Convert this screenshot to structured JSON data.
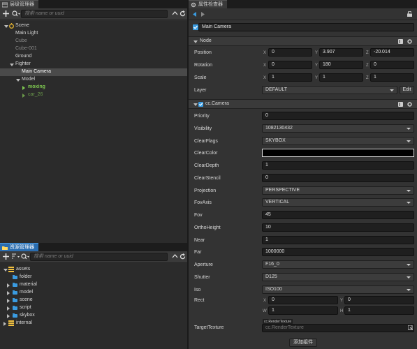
{
  "hierarchy": {
    "tab_label": "层级管理器",
    "search_placeholder": "搜索 name or uuid",
    "items": [
      {
        "label": "Scene"
      },
      {
        "label": "Main Light"
      },
      {
        "label": "Cube"
      },
      {
        "label": "Cube-001"
      },
      {
        "label": "Ground"
      },
      {
        "label": "Fighter"
      },
      {
        "label": "Main Camera"
      },
      {
        "label": "Model"
      },
      {
        "label": "moxing"
      },
      {
        "label": "car_26"
      }
    ]
  },
  "assets": {
    "tab_label": "资源管理器",
    "search_placeholder": "搜索 name or uuid",
    "items": [
      {
        "label": "assets"
      },
      {
        "label": "folder"
      },
      {
        "label": "material"
      },
      {
        "label": "model"
      },
      {
        "label": "scene"
      },
      {
        "label": "script"
      },
      {
        "label": "skybox"
      },
      {
        "label": "internal"
      }
    ]
  },
  "inspector": {
    "tab_label": "属性检查器",
    "node_name": "Main Camera",
    "node_section": "Node",
    "position": {
      "label": "Position",
      "x": "0",
      "y": "3.907",
      "z": "-20.014"
    },
    "rotation": {
      "label": "Rotation",
      "x": "0",
      "y": "180",
      "z": "0"
    },
    "scale": {
      "label": "Scale",
      "x": "1",
      "y": "1",
      "z": "1"
    },
    "layer": {
      "label": "Layer",
      "value": "DEFAULT",
      "edit": "Edit"
    },
    "axes": {
      "x": "X",
      "y": "Y",
      "z": "Z",
      "w": "W",
      "h": "H"
    },
    "camera_section": "cc.Camera",
    "props": [
      {
        "label": "Priority",
        "value": "0",
        "kind": "input"
      },
      {
        "label": "Visibility",
        "value": "1082130432",
        "kind": "select"
      },
      {
        "label": "ClearFlags",
        "value": "SKYBOX",
        "kind": "select"
      },
      {
        "label": "ClearColor",
        "value": "",
        "kind": "color"
      },
      {
        "label": "ClearDepth",
        "value": "1",
        "kind": "input"
      },
      {
        "label": "ClearStencil",
        "value": "0",
        "kind": "input"
      },
      {
        "label": "Projection",
        "value": "PERSPECTIVE",
        "kind": "select"
      },
      {
        "label": "FovAxis",
        "value": "VERTICAL",
        "kind": "select"
      },
      {
        "label": "Fov",
        "value": "45",
        "kind": "input"
      },
      {
        "label": "OrthoHeight",
        "value": "10",
        "kind": "input"
      },
      {
        "label": "Near",
        "value": "1",
        "kind": "input"
      },
      {
        "label": "Far",
        "value": "1000000",
        "kind": "input"
      },
      {
        "label": "Aperture",
        "value": "F16_0",
        "kind": "select"
      },
      {
        "label": "Shutter",
        "value": "D125",
        "kind": "select"
      },
      {
        "label": "Iso",
        "value": "ISO100",
        "kind": "select"
      }
    ],
    "rect": {
      "label": "Rect",
      "x": "0",
      "y": "0",
      "w": "1",
      "h": "1"
    },
    "target_texture": {
      "label": "TargetTexture",
      "badge": "cc.RenderTexture",
      "value": "cc.RenderTexture"
    },
    "add_component": "添加组件",
    "colors": {
      "clear_color": "#000000",
      "accent": "#3a9be0",
      "model_green": "#7ec850"
    }
  }
}
